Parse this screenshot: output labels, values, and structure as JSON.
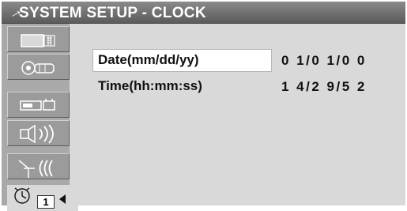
{
  "header": {
    "title": "SYSTEM SETUP - CLOCK",
    "title_glyph": "→"
  },
  "sidebar": {
    "items": [
      {
        "icon": "display-setup-icon",
        "active": false
      },
      {
        "icon": "video-tape-setup-icon",
        "active": false
      },
      {
        "icon": "camera-setup-icon",
        "active": false
      },
      {
        "icon": "audio-speaker-setup-icon",
        "active": false
      },
      {
        "icon": "antenna-signal-setup-icon",
        "active": false
      },
      {
        "icon": "clock-setup-icon",
        "active": true,
        "page_number": "1"
      }
    ]
  },
  "clock": {
    "date_label": "Date(mm/dd/yy)",
    "date_value": "0 1/0 1/0 0",
    "time_label": "Time(hh:mm:ss)",
    "time_value": "1 4/2 9/5 2"
  },
  "colors": {
    "title_bar": "#6f6f6f",
    "panel": "#d9d9d9",
    "sidebar": "#a9a9a9",
    "selected_field": "#ffffff"
  }
}
